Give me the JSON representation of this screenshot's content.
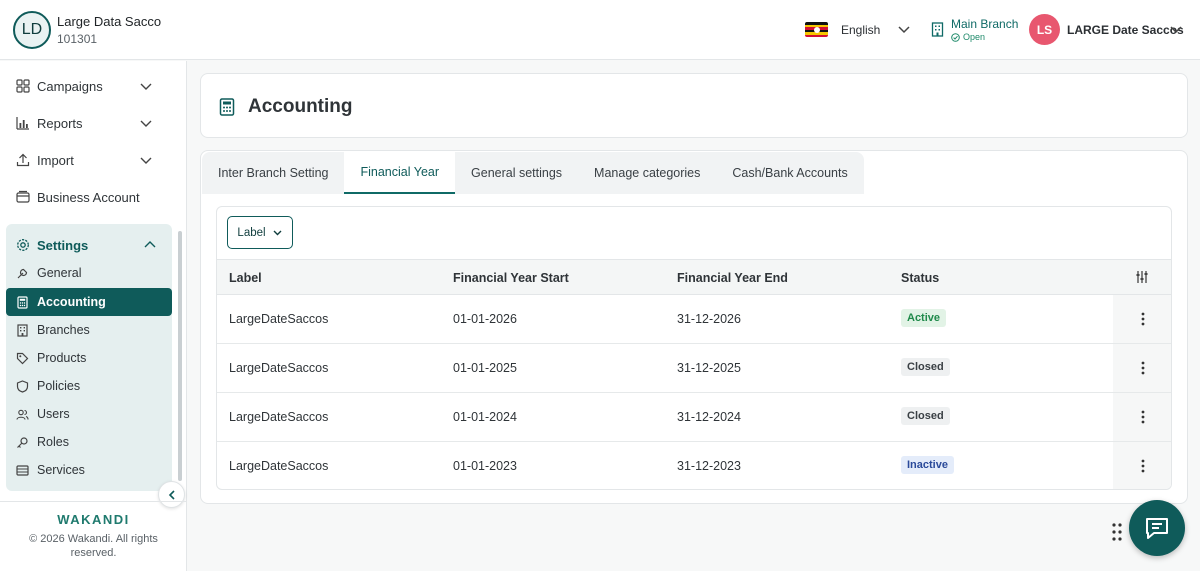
{
  "org": {
    "initials": "LD",
    "name": "Large Data Sacco",
    "id": "101301"
  },
  "topbar": {
    "language": "English",
    "branch_name": "Main Branch",
    "branch_status": "Open",
    "user_initials": "LS",
    "user_name": "LARGE Date Saccos"
  },
  "sidebar": {
    "items": [
      {
        "label": "Campaigns",
        "icon": "grid-icon"
      },
      {
        "label": "Reports",
        "icon": "bar-chart-icon"
      },
      {
        "label": "Import",
        "icon": "upload-icon"
      },
      {
        "label": "Business Account",
        "icon": "wallet-icon"
      }
    ],
    "settings": {
      "label": "Settings",
      "items": [
        {
          "label": "General",
          "icon": "wrench-icon"
        },
        {
          "label": "Accounting",
          "icon": "calculator-icon",
          "active": true
        },
        {
          "label": "Branches",
          "icon": "building-icon"
        },
        {
          "label": "Products",
          "icon": "tag-icon"
        },
        {
          "label": "Policies",
          "icon": "shield-icon"
        },
        {
          "label": "Users",
          "icon": "users-icon"
        },
        {
          "label": "Roles",
          "icon": "key-icon"
        },
        {
          "label": "Services",
          "icon": "server-icon"
        }
      ]
    },
    "brand": "WAKANDI",
    "copyright": "© 2026 Wakandi. All rights reserved."
  },
  "page": {
    "title": "Accounting"
  },
  "tabs": [
    {
      "label": "Inter Branch Setting"
    },
    {
      "label": "Financial Year",
      "active": true
    },
    {
      "label": "General settings"
    },
    {
      "label": "Manage categories"
    },
    {
      "label": "Cash/Bank Accounts"
    }
  ],
  "filter": {
    "label": "Label"
  },
  "table": {
    "headers": {
      "label": "Label",
      "start": "Financial Year Start",
      "end": "Financial Year End",
      "status": "Status"
    },
    "rows": [
      {
        "label": "LargeDateSaccos",
        "start": "01-01-2026",
        "end": "31-12-2026",
        "status": "Active",
        "status_kind": "active"
      },
      {
        "label": "LargeDateSaccos",
        "start": "01-01-2025",
        "end": "31-12-2025",
        "status": "Closed",
        "status_kind": "closed"
      },
      {
        "label": "LargeDateSaccos",
        "start": "01-01-2024",
        "end": "31-12-2024",
        "status": "Closed",
        "status_kind": "closed"
      },
      {
        "label": "LargeDateSaccos",
        "start": "01-01-2023",
        "end": "31-12-2023",
        "status": "Inactive",
        "status_kind": "inactive"
      }
    ]
  },
  "colors": {
    "primary": "#0f5b5a",
    "accent_pink": "#e8576f",
    "settings_bg": "#e5efef"
  }
}
